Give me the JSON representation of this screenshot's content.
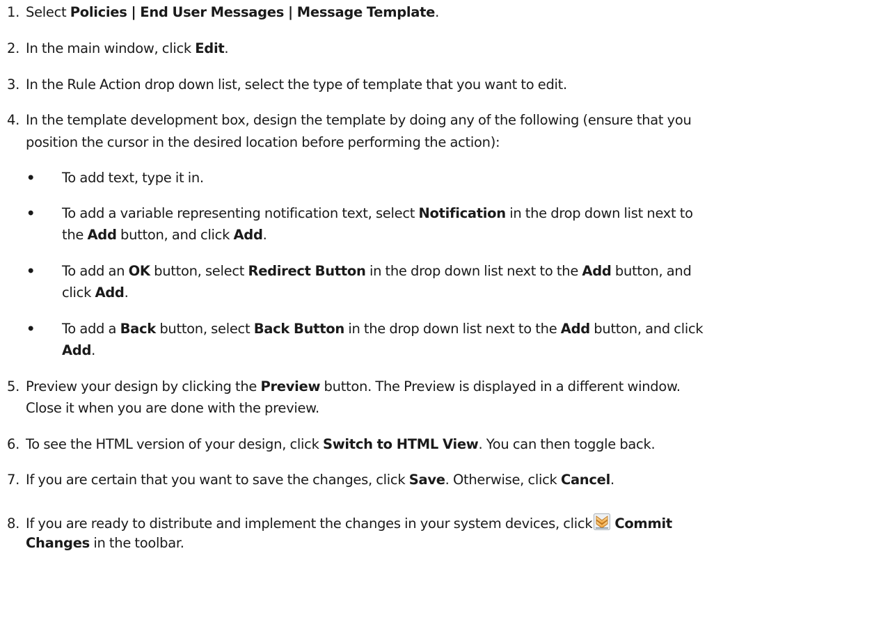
{
  "steps": [
    {
      "num": "1.",
      "parts": [
        "Select ",
        "Policies | End User Messages | Message Template",
        "."
      ]
    },
    {
      "num": "2.",
      "parts": [
        "In the main window, click ",
        "Edit",
        "."
      ]
    },
    {
      "num": "3.",
      "text": "In the Rule Action drop down list, select the type of template that you want to edit."
    },
    {
      "num": "4.",
      "line1": "In the template development box, design the template by doing any of the following (ensure that you",
      "line2": "position the cursor in the desired location before performing the action):"
    },
    {
      "num": "5.",
      "p1": "Preview your design by clicking the ",
      "b1": "Preview",
      "p2": " button. The Preview is displayed in a different window.",
      "line2": "Close it when you are done with the preview."
    },
    {
      "num": "6.",
      "parts": [
        "To see the HTML version of your design, click ",
        "Switch to HTML View",
        ". You can then toggle back."
      ]
    },
    {
      "num": "7.",
      "parts": [
        "If you are certain that you want to save the changes, click ",
        "Save",
        ". Otherwise, click ",
        "Cancel",
        "."
      ]
    },
    {
      "num": "8.",
      "p1": "If you are ready to distribute and implement the changes in your system devices, click",
      "b1": "Commit",
      "b2": "Changes",
      "p2": " in the toolbar."
    }
  ],
  "bullets": [
    {
      "dot": "•",
      "text": "To add text, type it in."
    },
    {
      "dot": "•",
      "p1": "To add a variable representing notification text, select ",
      "b1": "Notification",
      "p2": " in the drop down list next to",
      "p3": "the ",
      "b2": "Add",
      "p4": " button, and click ",
      "b3": "Add",
      "p5": "."
    },
    {
      "dot": "•",
      "p1": "To add an ",
      "b1": "OK",
      "p2": " button, select ",
      "b2": "Redirect Button",
      "p3": " in the drop down list next to the ",
      "b3": "Add",
      "p4": " button, and",
      "p5": "click ",
      "b4": "Add",
      "p6": "."
    },
    {
      "dot": "•",
      "p1": "To add a ",
      "b1": "Back",
      "p2": " button, select ",
      "b2": "Back Button",
      "p3": " in the drop down list next to the ",
      "b3": "Add",
      "p4": " button, and click",
      "b4": "Add",
      "p5": "."
    }
  ],
  "icons": {
    "commit": "commit-changes-icon"
  }
}
